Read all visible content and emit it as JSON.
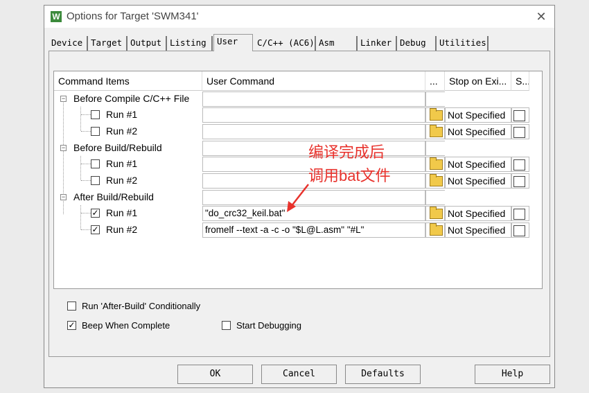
{
  "window": {
    "title": "Options for Target 'SWM341'",
    "icon_text": "W"
  },
  "tabs": [
    "Device",
    "Target",
    "Output",
    "Listing",
    "User",
    "C/C++ (AC6)",
    "Asm",
    "Linker",
    "Debug",
    "Utilities"
  ],
  "active_tab": "User",
  "grid": {
    "headers": [
      "Command Items",
      "User Command",
      "...",
      "Stop on Exi...",
      "S..."
    ],
    "groups": [
      {
        "label": "Before Compile C/C++ File",
        "runs": [
          {
            "label": "Run #1",
            "checked": false,
            "command": "",
            "stop": "Not Specified"
          },
          {
            "label": "Run #2",
            "checked": false,
            "command": "",
            "stop": "Not Specified"
          }
        ]
      },
      {
        "label": "Before Build/Rebuild",
        "runs": [
          {
            "label": "Run #1",
            "checked": false,
            "command": "",
            "stop": "Not Specified"
          },
          {
            "label": "Run #2",
            "checked": false,
            "command": "",
            "stop": "Not Specified"
          }
        ]
      },
      {
        "label": "After Build/Rebuild",
        "runs": [
          {
            "label": "Run #1",
            "checked": true,
            "command": "\"do_crc32_keil.bat\"",
            "stop": "Not Specified"
          },
          {
            "label": "Run #2",
            "checked": true,
            "command": "fromelf --text -a -c -o \"$L@L.asm\" \"#L\"",
            "stop": "Not Specified"
          }
        ]
      }
    ]
  },
  "options": {
    "run_after_build": {
      "label": "Run 'After-Build' Conditionally",
      "checked": false
    },
    "beep": {
      "label": "Beep When Complete",
      "checked": true
    },
    "start_debugging": {
      "label": "Start Debugging",
      "checked": false
    }
  },
  "buttons": {
    "ok": "OK",
    "cancel": "Cancel",
    "defaults": "Defaults",
    "help": "Help"
  },
  "annotation": {
    "line1": "编译完成后",
    "line2": "调用bat文件",
    "color": "#e8322c"
  }
}
